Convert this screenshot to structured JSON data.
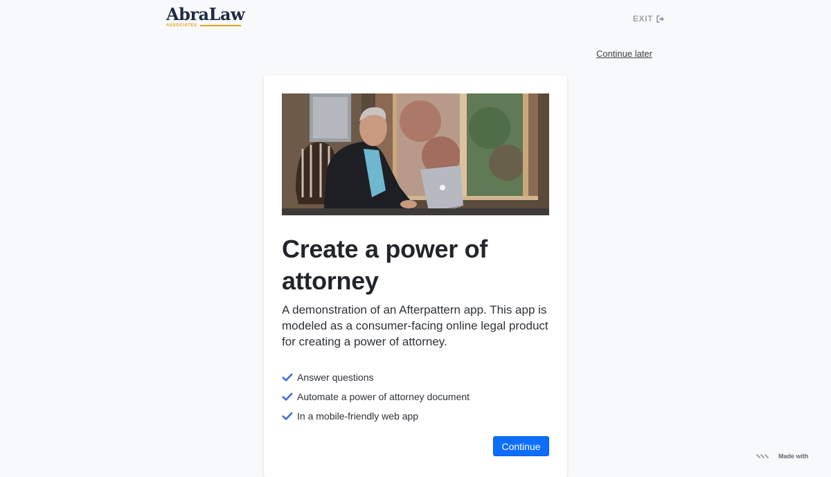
{
  "brand": {
    "name": "AbraLaw",
    "tagline": "ASSOCIATES",
    "accent_color": "#e3a21a"
  },
  "header": {
    "exit_label": "EXIT",
    "exit_icon": "sign-out-icon",
    "continue_later": "Continue later"
  },
  "card": {
    "image_alt": "Man working on a laptop by a window",
    "title": "Create a power of attorney",
    "description": "A demonstration of an Afterpattern app. This app is modeled as a consumer-facing online legal product for creating a power of attorney.",
    "features": [
      "Answer questions",
      "Automate a power of attorney document",
      "In a mobile-friendly web app"
    ],
    "check_icon": "check-icon",
    "check_color": "#3b6ee0",
    "continue_label": "Continue",
    "button_color": "#0d6efd"
  },
  "footer": {
    "made_with": "Made with"
  }
}
